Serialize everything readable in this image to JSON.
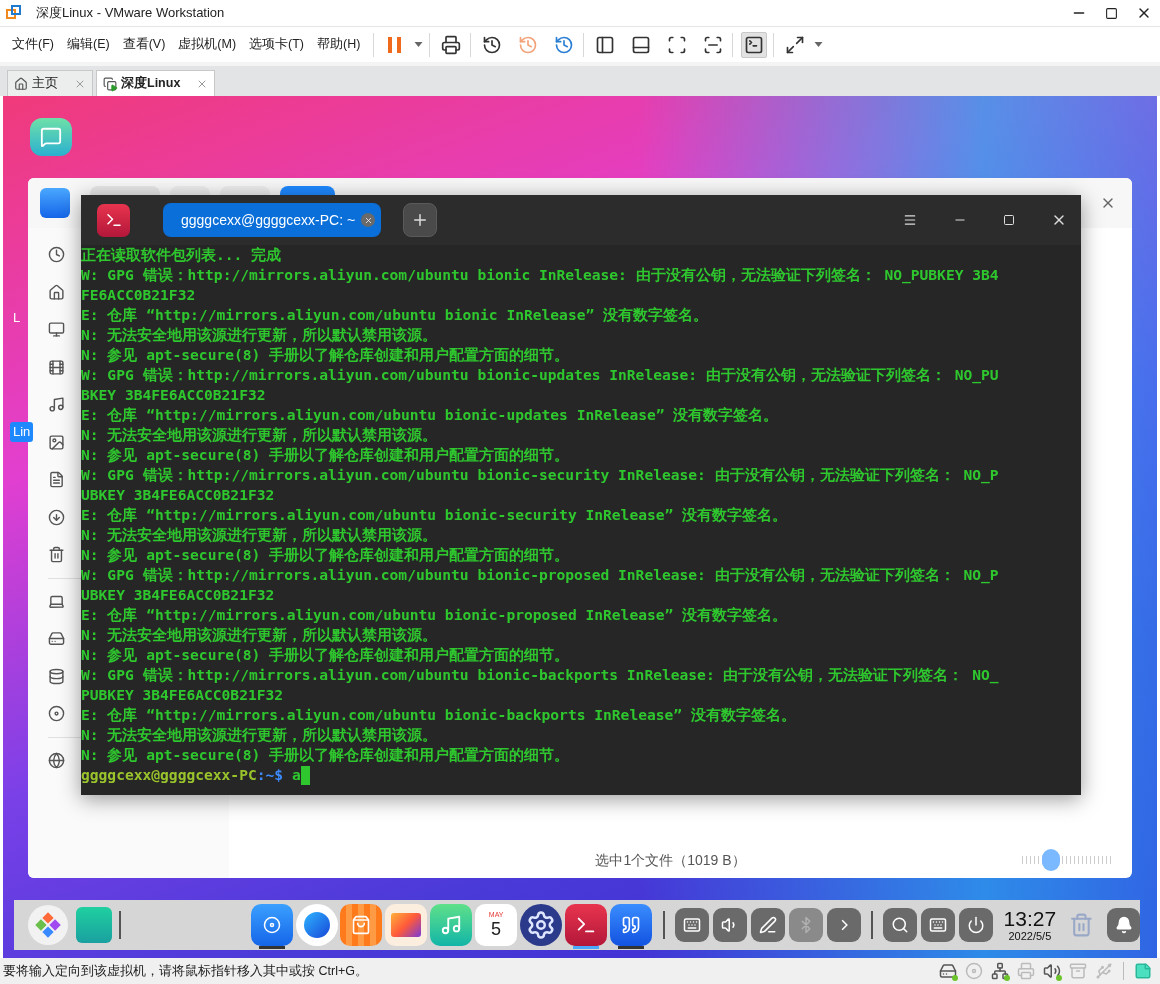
{
  "window": {
    "title": "深度Linux - VMware Workstation"
  },
  "menu": [
    "文件(F)",
    "编辑(E)",
    "查看(V)",
    "虚拟机(M)",
    "选项卡(T)",
    "帮助(H)"
  ],
  "toolbar_groups": [
    {
      "buttons": [
        {
          "kind": "pause",
          "selected": false,
          "dropdown": true
        }
      ]
    },
    {
      "buttons": [
        {
          "kind": "send-keys",
          "selected": false,
          "dropdown": false
        }
      ]
    },
    {
      "buttons": [
        {
          "kind": "snapshot-take",
          "selected": false,
          "dropdown": false
        },
        {
          "kind": "snapshot-revert",
          "selected": false,
          "dropdown": false
        },
        {
          "kind": "snapshot-manager",
          "selected": false,
          "dropdown": false
        }
      ]
    },
    {
      "buttons": [
        {
          "kind": "view-library",
          "selected": false,
          "dropdown": false
        },
        {
          "kind": "view-thumbnail",
          "selected": false,
          "dropdown": false
        },
        {
          "kind": "view-fit",
          "selected": false,
          "dropdown": false
        },
        {
          "kind": "view-unity",
          "selected": false,
          "dropdown": false
        }
      ]
    },
    {
      "buttons": [
        {
          "kind": "console",
          "selected": true,
          "dropdown": false
        }
      ]
    },
    {
      "buttons": [
        {
          "kind": "fullscreen",
          "selected": false,
          "dropdown": true
        }
      ]
    }
  ],
  "tabs": [
    {
      "label": "主页",
      "kind": "home",
      "selected": false
    },
    {
      "label": "深度Linux",
      "kind": "vm",
      "selected": true
    }
  ],
  "desktop_labels": [
    {
      "text": "L",
      "selected": false
    },
    {
      "text": "Lin",
      "selected": true
    }
  ],
  "file_manager": {
    "sidebar_sections": [
      {
        "items": [
          {
            "kind": "recent"
          },
          {
            "kind": "home"
          },
          {
            "kind": "desktop"
          },
          {
            "kind": "videos"
          },
          {
            "kind": "music"
          },
          {
            "kind": "pictures"
          },
          {
            "kind": "documents"
          },
          {
            "kind": "downloads"
          },
          {
            "kind": "trash"
          }
        ]
      },
      {
        "items": [
          {
            "kind": "computer"
          },
          {
            "kind": "system-disk"
          },
          {
            "kind": "data-disk"
          },
          {
            "kind": "dvd"
          }
        ]
      },
      {
        "items": [
          {
            "kind": "network"
          }
        ]
      }
    ],
    "status": "选中1个文件（1019 B）",
    "zoom": {
      "level": 0.22
    }
  },
  "terminal": {
    "tab": "ggggcexx@ggggcexx-PC: ~",
    "lines": [
      "正在读取软件包列表... 完成",
      "W: GPG 错误：http://mirrors.aliyun.com/ubuntu bionic InRelease: 由于没有公钥，无法验证下列签名： NO_PUBKEY 3B4",
      "FE6ACC0B21F32",
      "E: 仓库 “http://mirrors.aliyun.com/ubuntu bionic InRelease” 没有数字签名。",
      "N: 无法安全地用该源进行更新，所以默认禁用该源。",
      "N: 参见 apt-secure(8) 手册以了解仓库创建和用户配置方面的细节。",
      "W: GPG 错误：http://mirrors.aliyun.com/ubuntu bionic-updates InRelease: 由于没有公钥，无法验证下列签名： NO_PU",
      "BKEY 3B4FE6ACC0B21F32",
      "E: 仓库 “http://mirrors.aliyun.com/ubuntu bionic-updates InRelease” 没有数字签名。",
      "N: 无法安全地用该源进行更新，所以默认禁用该源。",
      "N: 参见 apt-secure(8) 手册以了解仓库创建和用户配置方面的细节。",
      "W: GPG 错误：http://mirrors.aliyun.com/ubuntu bionic-security InRelease: 由于没有公钥，无法验证下列签名： NO_P",
      "UBKEY 3B4FE6ACC0B21F32",
      "E: 仓库 “http://mirrors.aliyun.com/ubuntu bionic-security InRelease” 没有数字签名。",
      "N: 无法安全地用该源进行更新，所以默认禁用该源。",
      "N: 参见 apt-secure(8) 手册以了解仓库创建和用户配置方面的细节。",
      "W: GPG 错误：http://mirrors.aliyun.com/ubuntu bionic-proposed InRelease: 由于没有公钥，无法验证下列签名： NO_P",
      "UBKEY 3B4FE6ACC0B21F32",
      "E: 仓库 “http://mirrors.aliyun.com/ubuntu bionic-proposed InRelease” 没有数字签名。",
      "N: 无法安全地用该源进行更新，所以默认禁用该源。",
      "N: 参见 apt-secure(8) 手册以了解仓库创建和用户配置方面的细节。",
      "W: GPG 错误：http://mirrors.aliyun.com/ubuntu bionic-backports InRelease: 由于没有公钥，无法验证下列签名： NO_",
      "PUBKEY 3B4FE6ACC0B21F32",
      "E: 仓库 “http://mirrors.aliyun.com/ubuntu bionic-backports InRelease” 没有数字签名。",
      "N: 无法安全地用该源进行更新，所以默认禁用该源。",
      "N: 参见 apt-secure(8) 手册以了解仓库创建和用户配置方面的细节。"
    ],
    "prompt": {
      "user": "ggggcexx@ggggcexx-PC",
      "path": ":~$",
      "input": "a"
    }
  },
  "dock": {
    "left": [
      {
        "kind": "launcher"
      },
      {
        "kind": "multitask"
      }
    ],
    "apps": [
      {
        "kind": "files",
        "running": true,
        "active": false
      },
      {
        "kind": "browser",
        "running": false,
        "active": false
      },
      {
        "kind": "store",
        "running": false,
        "active": false
      },
      {
        "kind": "photos",
        "running": false,
        "active": false
      },
      {
        "kind": "music",
        "running": false,
        "active": false
      },
      {
        "kind": "calendar",
        "running": false,
        "active": false
      },
      {
        "kind": "settings",
        "running": false,
        "active": false
      },
      {
        "kind": "terminal",
        "running": true,
        "active": true
      },
      {
        "kind": "notes",
        "running": true,
        "active": false
      }
    ],
    "calendar": {
      "month": "MAY",
      "day": "5"
    },
    "tray": [
      {
        "kind": "keyboard",
        "disabled": false
      },
      {
        "kind": "volume",
        "disabled": false
      },
      {
        "kind": "pen",
        "disabled": false
      },
      {
        "kind": "bluetooth",
        "disabled": true
      },
      {
        "kind": "expand",
        "disabled": false
      }
    ],
    "system": [
      {
        "kind": "search"
      },
      {
        "kind": "onboard-keyboard"
      },
      {
        "kind": "power"
      }
    ],
    "clock": {
      "time": "13:27",
      "date": "2022/5/5"
    }
  },
  "status_bar": {
    "message": "要将输入定向到该虚拟机，请将鼠标指针移入其中或按 Ctrl+G。",
    "devices": [
      {
        "kind": "disk",
        "active": true
      },
      {
        "kind": "cd",
        "active": false
      },
      {
        "kind": "network",
        "active": true
      },
      {
        "kind": "printer",
        "active": false
      },
      {
        "kind": "sound",
        "active": true
      },
      {
        "kind": "archive",
        "active": false
      },
      {
        "kind": "usb",
        "active": false
      }
    ]
  }
}
